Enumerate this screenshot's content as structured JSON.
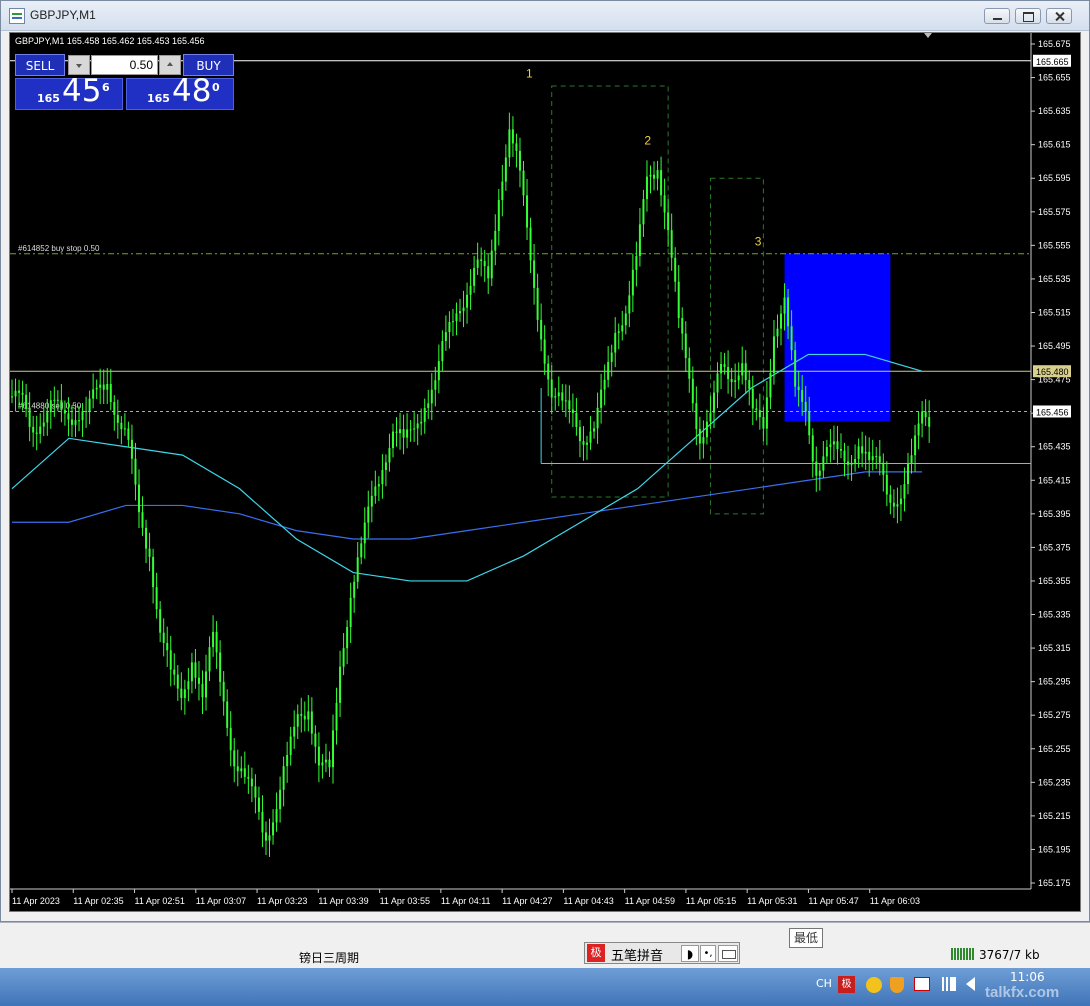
{
  "window": {
    "title": "GBPJPY,M1"
  },
  "chart": {
    "symbol_info": "GBPJPY,M1  165.458 165.462 165.453 165.456",
    "trade_panel": {
      "sell_label": "SELL",
      "buy_label": "BUY",
      "lot": "0.50",
      "sell_price": {
        "big": "165",
        "mid": "45",
        "sup": "6"
      },
      "buy_price": {
        "big": "165",
        "mid": "48",
        "sup": "0"
      }
    },
    "order_labels": {
      "buy_stop": "#614852 buy stop 0.50",
      "sell_order": "#614880 sell 0.50"
    },
    "annotations": [
      "1",
      "2",
      "3"
    ],
    "price_axis": [
      "165.675",
      "165.655",
      "165.635",
      "165.615",
      "165.595",
      "165.575",
      "165.555",
      "165.535",
      "165.515",
      "165.495",
      "165.475",
      "165.455",
      "165.435",
      "165.415",
      "165.395",
      "165.375",
      "165.355",
      "165.335",
      "165.315",
      "165.295",
      "165.275",
      "165.255",
      "165.235",
      "165.215",
      "165.195",
      "165.175"
    ],
    "price_tags": {
      "top": "165.665",
      "mid": "165.480",
      "bid": "165.456"
    },
    "time_axis": [
      "11 Apr 2023",
      "11 Apr 02:35",
      "11 Apr 02:51",
      "11 Apr 03:07",
      "11 Apr 03:23",
      "11 Apr 03:39",
      "11 Apr 03:55",
      "11 Apr 04:11",
      "11 Apr 04:27",
      "11 Apr 04:43",
      "11 Apr 04:59",
      "11 Apr 05:15",
      "11 Apr 05:31",
      "11 Apr 05:47",
      "11 Apr 06:03"
    ],
    "colors": {
      "bg": "#000000",
      "candle": "#33ff33",
      "ma_fast": "#3fd6e8",
      "ma_slow": "#3a6ff0",
      "rect_fill": "#0000ff",
      "rect_dashed": "#2a7a2a",
      "label": "#f0d040",
      "grid_level": "#cccc88"
    }
  },
  "chart_data": {
    "type": "candlestick",
    "symbol": "GBPJPY",
    "timeframe": "M1",
    "ylim": [
      165.175,
      165.675
    ],
    "close_path": [
      165.465,
      165.46,
      165.445,
      165.455,
      165.46,
      165.45,
      165.455,
      165.46,
      165.465,
      165.47,
      165.455,
      165.44,
      165.39,
      165.37,
      165.33,
      165.3,
      165.28,
      165.31,
      165.29,
      165.32,
      165.28,
      165.25,
      165.24,
      165.22,
      165.2,
      165.225,
      165.25,
      165.27,
      165.28,
      165.25,
      165.24,
      165.3,
      165.35,
      165.38,
      165.4,
      165.42,
      165.45,
      165.44,
      165.44,
      165.46,
      165.48,
      165.5,
      165.51,
      165.53,
      165.55,
      165.53,
      165.58,
      165.63,
      165.6,
      165.54,
      165.5,
      165.47,
      165.46,
      165.45,
      165.44,
      165.45,
      165.47,
      165.5,
      165.52,
      165.55,
      165.59,
      165.6,
      165.57,
      165.51,
      165.47,
      165.44,
      165.46,
      165.48,
      165.47,
      165.49,
      165.46,
      165.44,
      165.5,
      165.53,
      165.47,
      165.45,
      165.42,
      165.44,
      165.43,
      165.42,
      165.44,
      165.43,
      165.42,
      165.4,
      165.41,
      165.43,
      165.45
    ],
    "ma_fast": [
      165.41,
      165.44,
      165.435,
      165.43,
      165.41,
      165.38,
      165.36,
      165.355,
      165.355,
      165.37,
      165.39,
      165.41,
      165.44,
      165.47,
      165.49,
      165.49,
      165.48
    ],
    "ma_slow": [
      165.39,
      165.39,
      165.4,
      165.4,
      165.395,
      165.385,
      165.38,
      165.38,
      165.385,
      165.39,
      165.395,
      165.4,
      165.405,
      165.41,
      165.415,
      165.42,
      165.42
    ],
    "levels": [
      165.665,
      165.55,
      165.48,
      165.456,
      165.425
    ]
  },
  "statusbar": {
    "text": "镑日三周期",
    "tooltip": "最低",
    "connection": "3767/7 kb",
    "ime": {
      "logo": "极",
      "label": "五笔拼音",
      "moon": "◗",
      "punct": "•,",
      "keyboard": ""
    }
  },
  "taskbar": {
    "lang": "CH",
    "ime_icon": "极",
    "clock": "11:06",
    "watermark": "talkfx.com"
  }
}
